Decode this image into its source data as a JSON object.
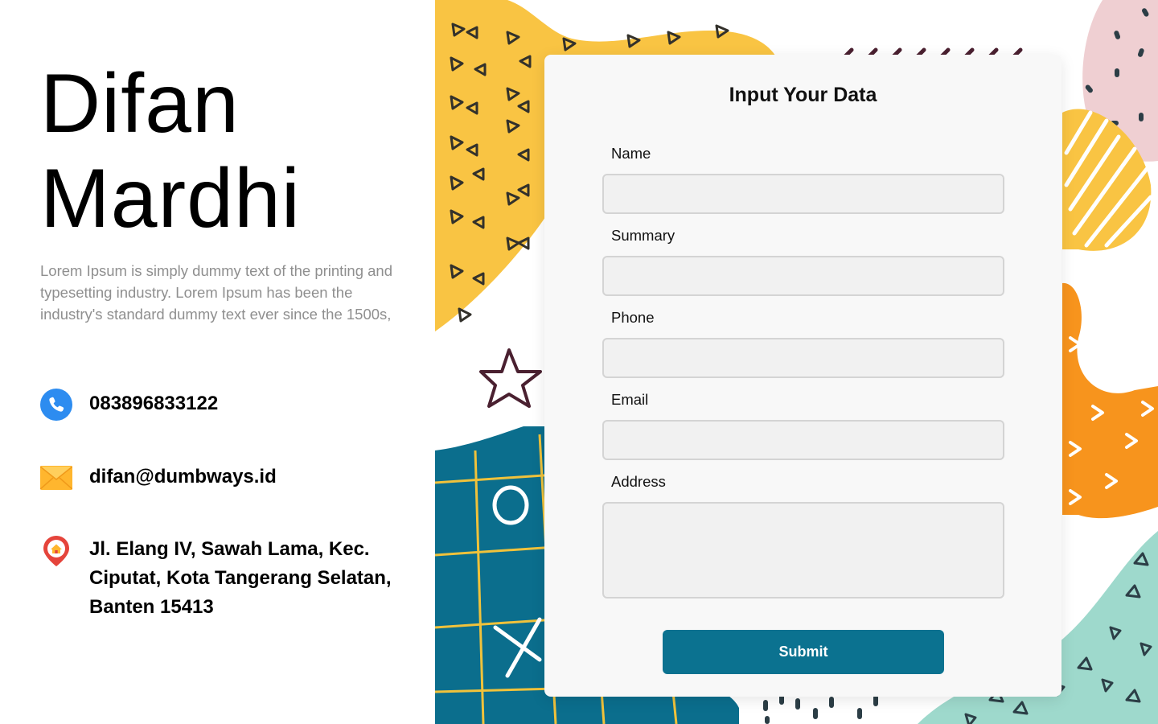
{
  "profile": {
    "first_name": "Difan",
    "last_name": "Mardhi",
    "bio": "Lorem Ipsum is simply dummy text of the printing and typesetting industry. Lorem Ipsum has been the industry's standard dummy text ever since the 1500s,",
    "phone": "083896833122",
    "email": "difan@dumbways.id",
    "address": "Jl. Elang IV, Sawah Lama, Kec. Ciputat, Kota Tangerang Selatan, Banten 15413"
  },
  "icons": {
    "phone": "phone-icon",
    "email": "envelope-icon",
    "address": "location-pin-icon"
  },
  "form": {
    "title": "Input Your Data",
    "fields": [
      {
        "label": "Name",
        "value": ""
      },
      {
        "label": "Summary",
        "value": ""
      },
      {
        "label": "Phone",
        "value": ""
      },
      {
        "label": "Email",
        "value": ""
      },
      {
        "label": "Address",
        "value": ""
      }
    ],
    "submit_label": "Submit"
  },
  "colors": {
    "accent": "#0b7290",
    "yellow": "#f9c443",
    "teal_board": "#0b6e8d",
    "orange": "#f7941d",
    "mint": "#9ed9cc",
    "pink": "#efcfd2",
    "phone_blue": "#2d8cf0",
    "envelope_yellow": "#ffb62e",
    "pin_red": "#e5443b"
  }
}
